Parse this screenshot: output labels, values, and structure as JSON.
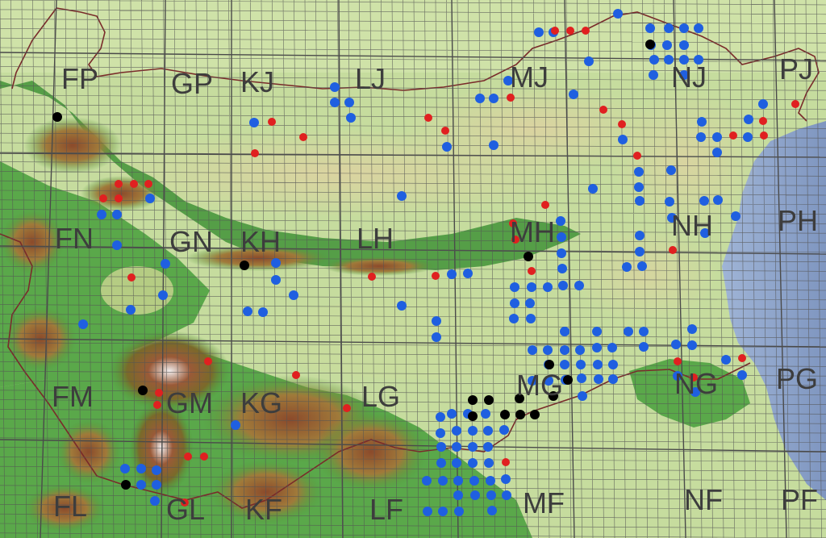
{
  "map": {
    "colors": {
      "sea": "#8fa6c8",
      "lowland": "#c9dea0",
      "plateau": "#d9d2a2",
      "forest": "#3f8e3a",
      "mountain_brown": "#8b4a2b",
      "peak": "#e8e0e0",
      "grid": "#555555",
      "border": "#7a2a2a",
      "dot_blue": "#1f5fe0",
      "dot_red": "#e02020",
      "dot_black": "#000000"
    },
    "square_labels": [
      {
        "id": "FP",
        "text": "FP"
      },
      {
        "id": "GP",
        "text": "GP"
      },
      {
        "id": "KJ",
        "text": "KJ"
      },
      {
        "id": "LJ",
        "text": "LJ"
      },
      {
        "id": "MJ",
        "text": "MJ"
      },
      {
        "id": "NJ",
        "text": "NJ"
      },
      {
        "id": "PJ",
        "text": "PJ"
      },
      {
        "id": "FN",
        "text": "FN"
      },
      {
        "id": "GN",
        "text": "GN"
      },
      {
        "id": "KH",
        "text": "KH"
      },
      {
        "id": "LH",
        "text": "LH"
      },
      {
        "id": "MH",
        "text": "MH"
      },
      {
        "id": "NH",
        "text": "NH"
      },
      {
        "id": "PH",
        "text": "PH"
      },
      {
        "id": "FM",
        "text": "FM"
      },
      {
        "id": "GM",
        "text": "GM"
      },
      {
        "id": "KG",
        "text": "KG"
      },
      {
        "id": "LG",
        "text": "LG"
      },
      {
        "id": "MG",
        "text": "MG"
      },
      {
        "id": "NG",
        "text": "NG"
      },
      {
        "id": "PG",
        "text": "PG"
      },
      {
        "id": "FL",
        "text": "FL"
      },
      {
        "id": "GL",
        "text": "GL"
      },
      {
        "id": "KF",
        "text": "KF"
      },
      {
        "id": "LF",
        "text": "LF"
      },
      {
        "id": "MF",
        "text": "MF"
      },
      {
        "id": "NF",
        "text": "NF"
      },
      {
        "id": "PF",
        "text": "PF"
      }
    ]
  }
}
